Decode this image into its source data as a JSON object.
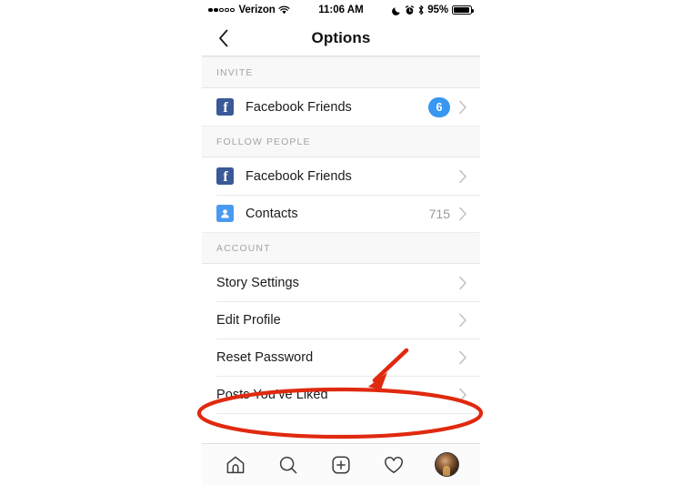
{
  "status_bar": {
    "signal_dots_filled": 2,
    "signal_dots_total": 5,
    "carrier": "Verizon",
    "wifi_icon": "wifi-icon",
    "time": "11:06 AM",
    "do_not_disturb_icon": "moon-icon",
    "alarm_icon": "alarm-clock-icon",
    "bluetooth_icon": "bluetooth-icon",
    "battery_percent": "95%",
    "battery_icon": "battery-icon"
  },
  "nav": {
    "back_icon": "back-chevron-icon",
    "title": "Options"
  },
  "sections": [
    {
      "header": "INVITE",
      "rows": [
        {
          "label": "Facebook Friends",
          "icon": "facebook-icon",
          "icon_glyph": "f",
          "badge": "6",
          "value": "",
          "chevron": "chevron-right-icon"
        }
      ]
    },
    {
      "header": "FOLLOW PEOPLE",
      "rows": [
        {
          "label": "Facebook Friends",
          "icon": "facebook-icon",
          "icon_glyph": "f",
          "badge": "",
          "value": "",
          "chevron": "chevron-right-icon"
        },
        {
          "label": "Contacts",
          "icon": "contacts-icon",
          "icon_glyph": "",
          "badge": "",
          "value": "715",
          "chevron": "chevron-right-icon"
        }
      ]
    },
    {
      "header": "ACCOUNT",
      "rows": [
        {
          "label": "Story Settings",
          "icon": "",
          "icon_glyph": "",
          "badge": "",
          "value": "",
          "chevron": "chevron-right-icon"
        },
        {
          "label": "Edit Profile",
          "icon": "",
          "icon_glyph": "",
          "badge": "",
          "value": "",
          "chevron": "chevron-right-icon"
        },
        {
          "label": "Reset Password",
          "icon": "",
          "icon_glyph": "",
          "badge": "",
          "value": "",
          "chevron": "chevron-right-icon"
        },
        {
          "label": "Posts You’ve Liked",
          "icon": "",
          "icon_glyph": "",
          "badge": "",
          "value": "",
          "chevron": "chevron-right-icon",
          "highlighted": true
        }
      ]
    }
  ],
  "tab_bar": {
    "tabs": [
      {
        "name": "home-icon"
      },
      {
        "name": "search-icon"
      },
      {
        "name": "add-post-icon"
      },
      {
        "name": "activity-heart-icon"
      },
      {
        "name": "profile-avatar"
      }
    ]
  },
  "annotations": {
    "highlight_color": "#e0290f",
    "ellipse_target": "Posts You’ve Liked",
    "arrow": "pointer-arrow"
  }
}
